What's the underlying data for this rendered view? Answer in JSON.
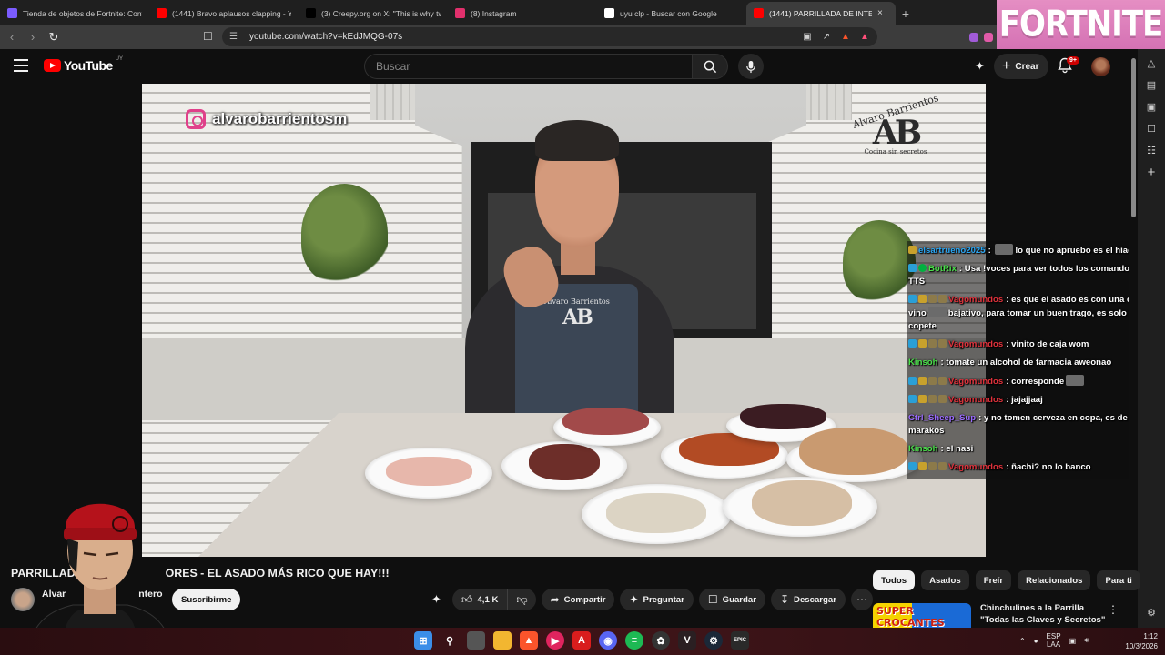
{
  "browser": {
    "tabs": [
      {
        "title": "Tienda de objetos de Fortnite: Conte",
        "favicon": "fortnite-icon",
        "color": "#7b5cff",
        "active": false
      },
      {
        "title": "(1441) Bravo aplausos clapping - You",
        "favicon": "youtube-icon",
        "color": "#ff0000",
        "active": false
      },
      {
        "title": "(3) Creepy.org on X: \"This is why two",
        "favicon": "x-icon",
        "color": "#000000",
        "active": false
      },
      {
        "title": "(8) Instagram",
        "favicon": "instagram-icon",
        "color": "#e1306c",
        "active": false
      },
      {
        "title": "uyu clp - Buscar con Google",
        "favicon": "google-icon",
        "color": "#ffffff",
        "active": false
      },
      {
        "title": "(1441) PARRILLADA DE INTERIO",
        "favicon": "youtube-icon",
        "color": "#ff0000",
        "active": true
      }
    ],
    "url": "youtube.com/watch?v=kEdJMQG-07s",
    "banner_text": "FORTNITE"
  },
  "youtube": {
    "logo_text": "YouTube",
    "country_code": "UY",
    "search_placeholder": "Buscar",
    "create_label": "Crear",
    "notification_count": "9+"
  },
  "video": {
    "instagram_handle": "alvarobarrientosm",
    "brand_name": "Alvaro Barrientos",
    "brand_monogram": "AB",
    "brand_slogan": "Cocina sin secretos"
  },
  "chat": {
    "messages": [
      {
        "user": "elsartrueno2025",
        "user_color": "#2aa7f5",
        "text": "lo que no apruebo es el hiachi",
        "badges": [
          "vip"
        ],
        "emote": true
      },
      {
        "user": "BotRix",
        "user_color": "#4be14b",
        "text": "Usa !voces para ver todos los comandos del TTS",
        "badges": [
          "mod",
          "bot"
        ],
        "emote": false
      },
      {
        "user": "Vagomundos",
        "user_color": "#e0323c",
        "text": "es que el asado es con una copa de vino",
        "text2": "bajativo, para tomar un buen trago, es solo el copete",
        "badges": [
          "mod",
          "vip",
          "sub",
          "sub"
        ],
        "emote": true
      },
      {
        "user": "Vagomundos",
        "user_color": "#e0323c",
        "text": "vinito de caja wom",
        "badges": [
          "mod",
          "vip",
          "sub",
          "sub"
        ],
        "emote": false
      },
      {
        "user": "Kinsoh",
        "user_color": "#4be14b",
        "text": "tomate un alcohol de farmacia aweonao",
        "badges": [],
        "emote": false
      },
      {
        "user": "Vagomundos",
        "user_color": "#e0323c",
        "text": "corresponde",
        "badges": [
          "mod",
          "vip",
          "sub",
          "sub"
        ],
        "emote": true
      },
      {
        "user": "Vagomundos",
        "user_color": "#e0323c",
        "text": "jajajjaaj",
        "badges": [
          "mod",
          "vip",
          "sub",
          "sub"
        ],
        "emote": false
      },
      {
        "user": "Ctrl_Sheep_Sup",
        "user_color": "#9b6bff",
        "text": "y no tomen cerveza en copa, es de marakos",
        "badges": [],
        "emote": false
      },
      {
        "user": "Kinsoh",
        "user_color": "#4be14b",
        "text": "el nasi",
        "badges": [],
        "emote": false
      },
      {
        "user": "Vagomundos",
        "user_color": "#e0323c",
        "text": "ñachi? no lo banco",
        "badges": [
          "mod",
          "vip",
          "sub",
          "sub"
        ],
        "emote": false
      }
    ]
  },
  "below": {
    "title_start": "PARRILLADA",
    "title_end": "ORES - EL ASADO MÁS RICO QUE HAY!!!",
    "channel_start": "Alvar",
    "channel_end": "ntero",
    "subscribe_label": "Suscribirme",
    "like_count": "4,1 K",
    "share_label": "Compartir",
    "ask_label": "Preguntar",
    "save_label": "Guardar",
    "download_label": "Descargar",
    "chips": [
      "Todos",
      "Asados",
      "Freír",
      "Relacionados",
      "Para ti"
    ],
    "rec_title": "Chinchulines a la Parrilla \"Todas las Claves y Secretos\"",
    "rec_thumb_text": "SUPER CROCANTES"
  },
  "taskbar": {
    "lang_line1": "ESP",
    "lang_line2": "LAA",
    "time": "1:12",
    "date": "10/3/2026"
  }
}
